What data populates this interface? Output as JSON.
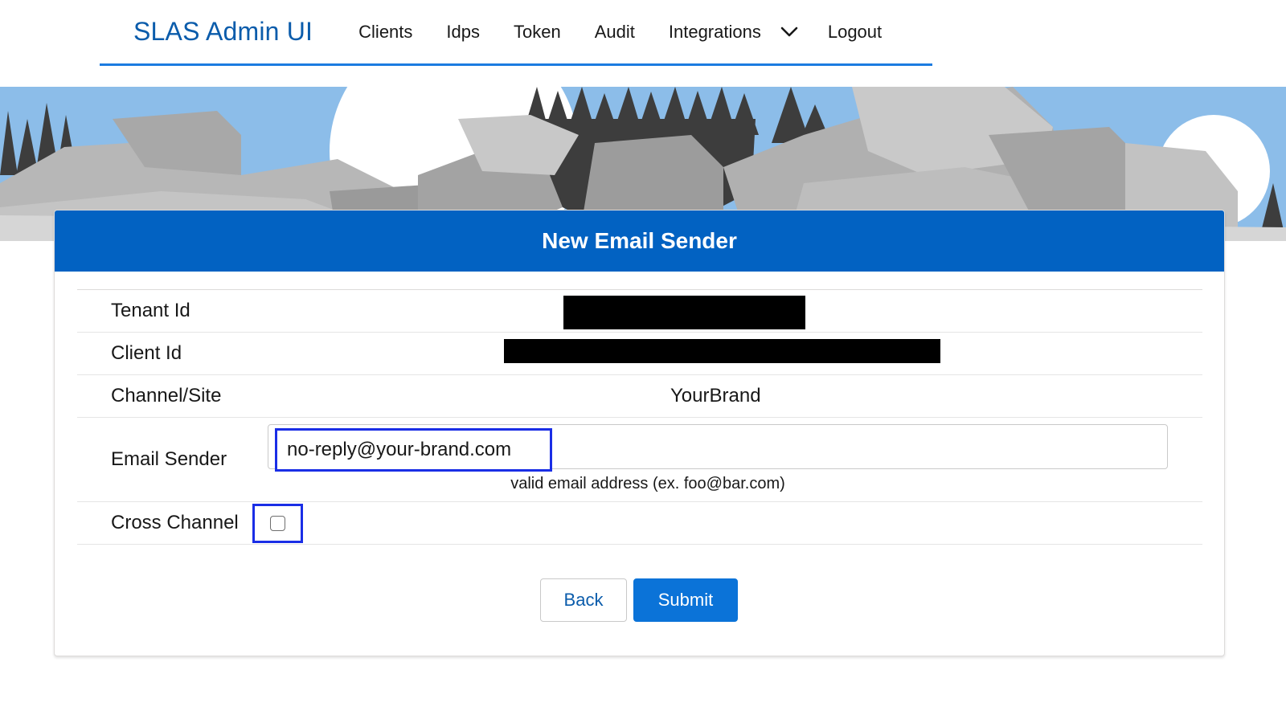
{
  "app": {
    "title": "SLAS Admin UI"
  },
  "nav": {
    "items": [
      {
        "label": "Clients"
      },
      {
        "label": "Idps"
      },
      {
        "label": "Token"
      },
      {
        "label": "Audit"
      },
      {
        "label": "Integrations"
      },
      {
        "label": "Logout"
      }
    ],
    "integrations_icon": "chevron-down-icon"
  },
  "card": {
    "title": "New Email Sender"
  },
  "form": {
    "tenant_id": {
      "label": "Tenant Id",
      "value_redacted": true
    },
    "client_id": {
      "label": "Client Id",
      "value_redacted": true
    },
    "channel_site": {
      "label": "Channel/Site",
      "value": "YourBrand"
    },
    "email_sender": {
      "label": "Email Sender",
      "value": "no-reply@your-brand.com",
      "help": "valid email address (ex. foo@bar.com)"
    },
    "cross_channel": {
      "label": "Cross Channel",
      "checked": false
    }
  },
  "buttons": {
    "back": "Back",
    "submit": "Submit"
  },
  "colors": {
    "brand": "#0b5cab",
    "header_bar": "#0262c2",
    "submit": "#0b73d8",
    "highlight": "#1a2ee6"
  }
}
